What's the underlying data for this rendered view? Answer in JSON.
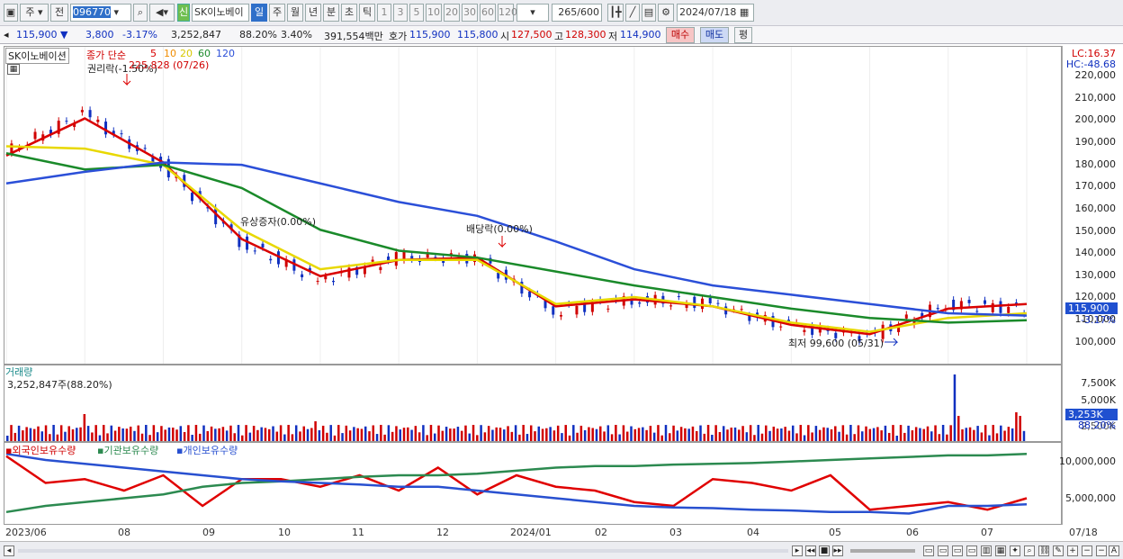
{
  "toolbar": {
    "type": "주",
    "view": "전",
    "code": "096770",
    "name": "SK이노베이",
    "credit": "신",
    "periods": [
      "일",
      "주",
      "월",
      "년",
      "분",
      "초",
      "틱"
    ],
    "nums": [
      "1",
      "3",
      "5",
      "10",
      "20",
      "30",
      "60",
      "120"
    ],
    "count": "265",
    "count_max": "/600",
    "date": "2024/07/18"
  },
  "quote": {
    "price": "115,900",
    "arrow": "▼",
    "change": "3,800",
    "rate": "-3.17%",
    "volume": "3,252,847",
    "vol_rate": "88.20%",
    "turnover": "3.40%",
    "amount": "391,554백만",
    "bid_label": "호가",
    "ask": "115,900",
    "bid": "115,800",
    "open_label": "시",
    "open": "127,500",
    "high_label": "고",
    "high": "128,300",
    "low_label": "저",
    "low": "114,900",
    "buy": "매수",
    "sell": "매도",
    "avg": "평"
  },
  "price_panel": {
    "title": "SK이노베이션",
    "ma_label": "종가 단순",
    "ma_periods": [
      "5",
      "10",
      "20",
      "60",
      "120"
    ],
    "lc": "LC:16.37",
    "hc": "HC:-48.68",
    "y_ticks": [
      "220,000",
      "210,000",
      "200,000",
      "190,000",
      "180,000",
      "170,000",
      "160,000",
      "150,000",
      "140,000",
      "130,000",
      "120,000",
      "110,000",
      "100,000"
    ],
    "cur_price": "115,900",
    "cur_rate": "-3.17%",
    "ann_rights": "권리락(-1.50%)",
    "ann_high": "225,828 (07/26)",
    "ann_raise": "유상증자(0.00%)",
    "ann_div": "배당락(0.00%)",
    "ann_low": "최저 99,600 (05/31)"
  },
  "volume_panel": {
    "title": "거래량",
    "value": "3,252,847주(88.20%)",
    "y_ticks": [
      "7,500K",
      "5,000K",
      "2,500K"
    ],
    "cur": "3,253K",
    "cur_rate": "88.20%"
  },
  "holding_panel": {
    "legend": [
      "외국인보유수량",
      "기관보유수량",
      "개인보유수량"
    ],
    "y_ticks": [
      "10,000,000",
      "5,000,000"
    ]
  },
  "x_ticks": [
    "2023/06",
    "08",
    "09",
    "10",
    "11",
    "12",
    "2024/01",
    "02",
    "03",
    "04",
    "05",
    "06",
    "07",
    "07/18"
  ],
  "colors": {
    "ma5": "#d90000",
    "ma10": "#f08c00",
    "ma20": "#e8d800",
    "ma60": "#1a8a2a",
    "ma120": "#2b4fd8",
    "up": "#d00000",
    "down": "#1030c0",
    "foreign": "#e00000",
    "inst": "#2c8a50",
    "indiv": "#2850d0"
  },
  "chart_data": {
    "type": "line",
    "x": [
      "2023/06",
      "08",
      "09",
      "10",
      "11",
      "12",
      "2024/01",
      "02",
      "03",
      "04",
      "05",
      "06",
      "07",
      "07/18"
    ],
    "series": [
      {
        "name": "종가",
        "values": [
          183000,
          200000,
          178000,
          145000,
          128000,
          138000,
          138000,
          115000,
          120000,
          118000,
          108000,
          104000,
          118000,
          115900
        ]
      },
      {
        "name": "5",
        "values": [
          182000,
          198000,
          179000,
          146000,
          130000,
          137000,
          138000,
          117000,
          120000,
          117000,
          109000,
          105000,
          116000,
          118000
        ]
      },
      {
        "name": "20",
        "values": [
          186000,
          185000,
          178000,
          150000,
          133000,
          137000,
          137000,
          118000,
          121000,
          117000,
          110000,
          106000,
          112000,
          114000
        ]
      },
      {
        "name": "60",
        "values": [
          183000,
          176000,
          178000,
          168000,
          150000,
          141000,
          138000,
          132000,
          126000,
          121000,
          116000,
          112000,
          110000,
          111000
        ]
      },
      {
        "name": "120",
        "values": [
          170000,
          175000,
          179000,
          178000,
          170000,
          162000,
          156000,
          145000,
          133000,
          126000,
          122000,
          118000,
          114000,
          113000
        ]
      }
    ],
    "ylim": [
      95000,
      225000
    ]
  }
}
